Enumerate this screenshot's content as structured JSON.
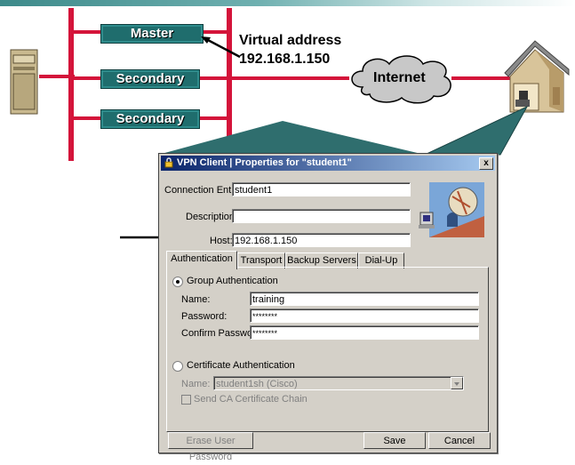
{
  "diagram": {
    "routers": [
      "Master",
      "Secondary",
      "Secondary"
    ],
    "virtual_label_line1": "Virtual address",
    "virtual_label_line2": "192.168.1.150",
    "cloud_label": "Internet"
  },
  "dialog": {
    "title": "VPN Client  |  Properties for \"student1\"",
    "close_glyph": "x",
    "connection_entry_label": "Connection Entry:",
    "connection_entry_value": "student1",
    "description_label": "Description:",
    "description_value": "",
    "host_label": "Host:",
    "host_value": "192.168.1.150",
    "tabs": [
      "Authentication",
      "Transport",
      "Backup Servers",
      "Dial-Up"
    ],
    "active_tab": "Authentication",
    "group_auth_label": "Group Authentication",
    "name_label": "Name:",
    "name_value": "training",
    "password_label": "Password:",
    "password_value": "********",
    "confirm_label": "Confirm Password:",
    "confirm_value": "********",
    "cert_auth_label": "Certificate Authentication",
    "cert_name_label": "Name:",
    "cert_name_value": "student1sh (Cisco)",
    "send_ca_label": "Send CA Certificate Chain",
    "erase_button": "Erase User Password",
    "save_button": "Save",
    "cancel_button": "Cancel"
  },
  "colors": {
    "network_line": "#d4143a",
    "router": "#1f6d6d",
    "titlebar": "#0a246a"
  }
}
